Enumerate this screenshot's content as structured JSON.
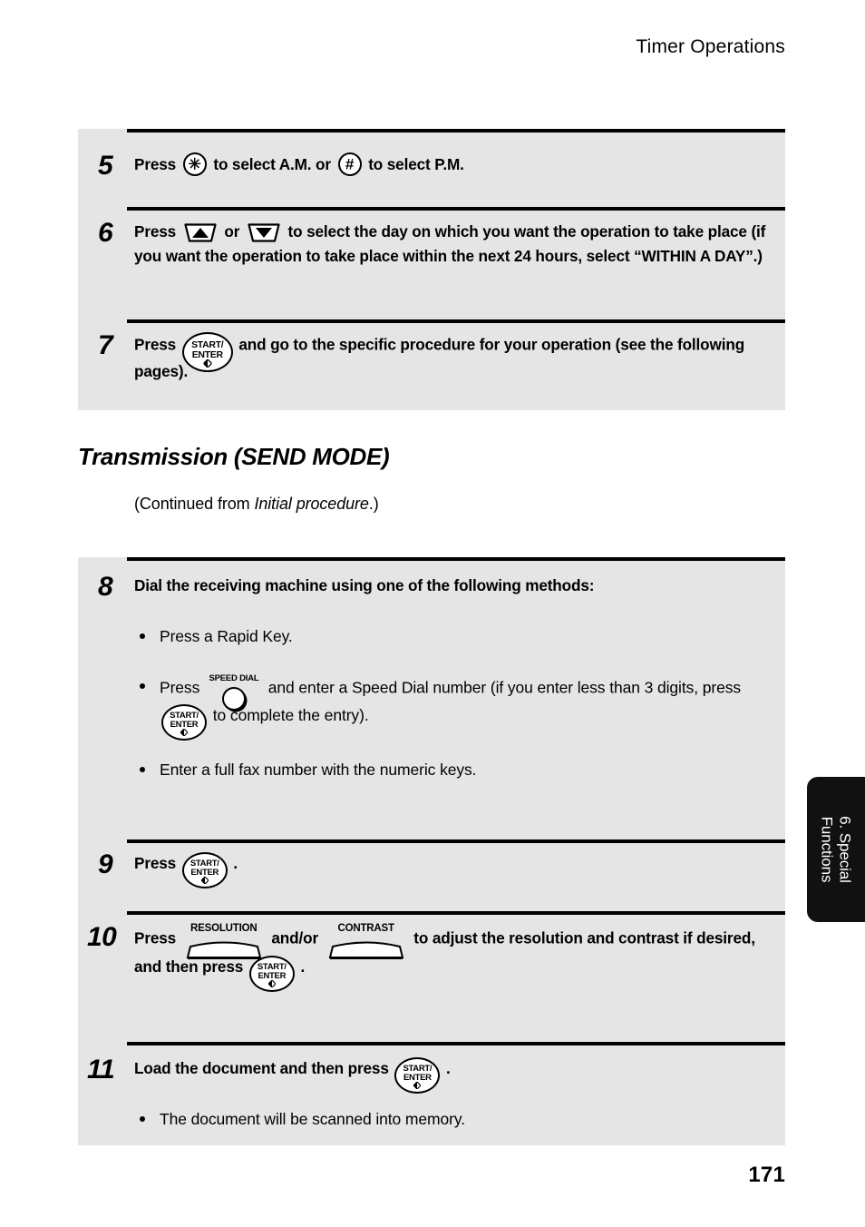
{
  "page": {
    "running_head": "Timer Operations",
    "folio": "171",
    "background": "#ffffff",
    "panel_color": "#e5e5e5",
    "rule_color": "#000000"
  },
  "side_tab": {
    "line1": "6. Special",
    "line2": "Functions",
    "background": "#111111",
    "text_color": "#ffffff"
  },
  "keys": {
    "asterisk": "✳",
    "pound": "#",
    "start_enter_line1": "START/",
    "start_enter_line2": "ENTER",
    "speed_dial_caption": "SPEED DIAL",
    "resolution_caption": "RESOLUTION",
    "contrast_caption": "CONTRAST",
    "arrow_up": "up-arrow-key",
    "arrow_down": "down-arrow-key"
  },
  "top_panel": {
    "steps": [
      {
        "number": "5",
        "text_a": "Press",
        "text_b": "to select A.M. or",
        "text_c": "to select P.M."
      },
      {
        "number": "6",
        "text_a": "Press",
        "text_b": "or",
        "text_c": "to select the day on which you want the operation to take place (if you want the operation to take place within the next 24 hours, select “WITHIN A DAY”.)"
      },
      {
        "number": "7",
        "text_a": "Press",
        "text_b": "and go to the specific procedure for your operation (see the following pages)."
      }
    ]
  },
  "section": {
    "heading": "Transmission (SEND MODE)",
    "subtitle_before": "(Continued from ",
    "subtitle_italic": "Initial procedure",
    "subtitle_after": ".)"
  },
  "main_panel": {
    "steps": [
      {
        "number": "8",
        "text_a": "Dial the receiving machine using one of the following methods:",
        "bullets": [
          {
            "text_a": "Press a Rapid Key."
          },
          {
            "text_a": "Press",
            "text_b": "and enter a Speed Dial number (if you enter less than 3 digits, press",
            "text_c": "to complete the entry)."
          },
          {
            "text_a": "Enter a full fax number with the numeric keys."
          }
        ]
      },
      {
        "number": "9",
        "text_a": "Press",
        "text_b": "."
      },
      {
        "number": "10",
        "text_a": "Press",
        "text_b": "and/or",
        "text_c": "to adjust the resolution and contrast if desired, and then press",
        "text_d": "."
      },
      {
        "number": "11",
        "text_a": "Load the document and then press",
        "text_b": ".",
        "bullets": [
          {
            "text_a": "The document will be scanned into memory."
          }
        ]
      }
    ]
  }
}
